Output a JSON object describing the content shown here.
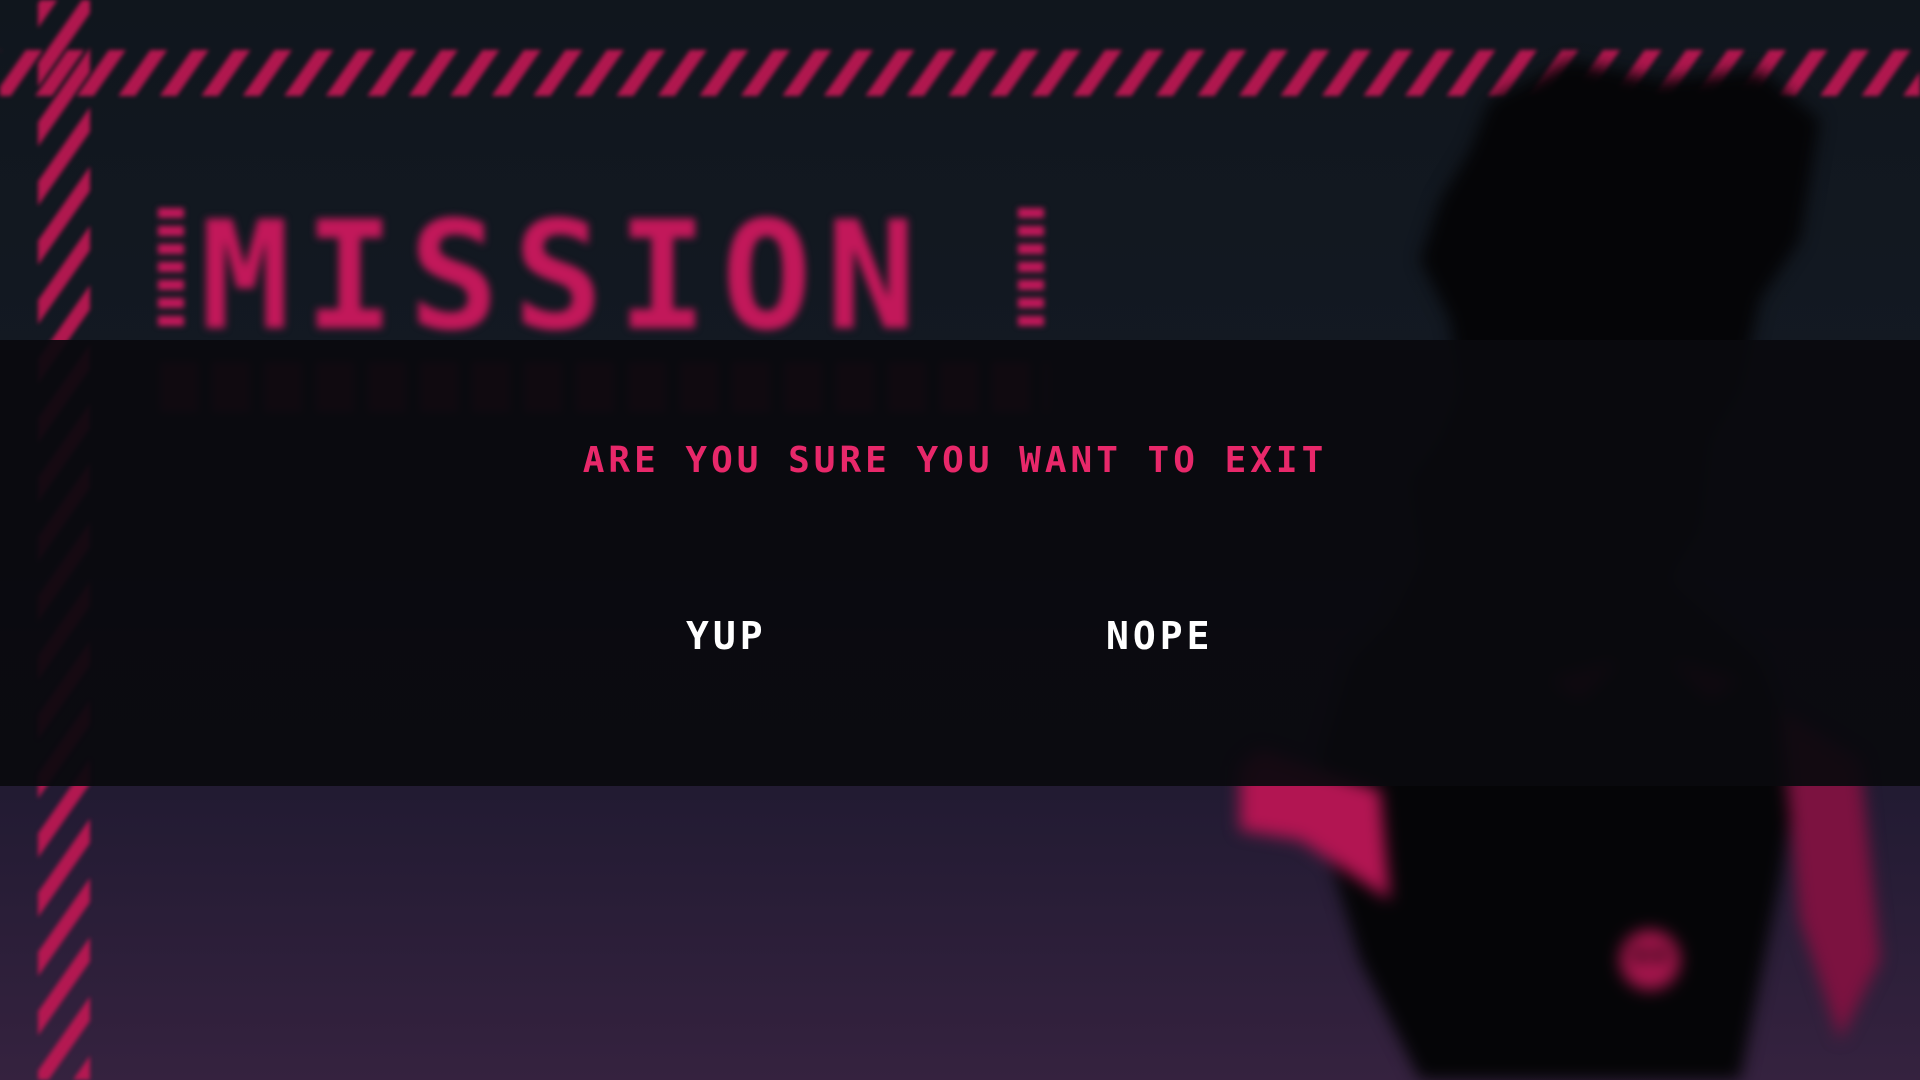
{
  "background": {
    "title": "MISSION",
    "menu_items": [
      "",
      "",
      "",
      ""
    ]
  },
  "dialog": {
    "prompt": "ARE YOU SURE YOU WANT TO EXIT",
    "confirm_label": "YUP",
    "cancel_label": "NOPE"
  },
  "colors": {
    "accent": "#e8286a",
    "overlay": "#0a0a0e",
    "text": "#ffffff"
  }
}
